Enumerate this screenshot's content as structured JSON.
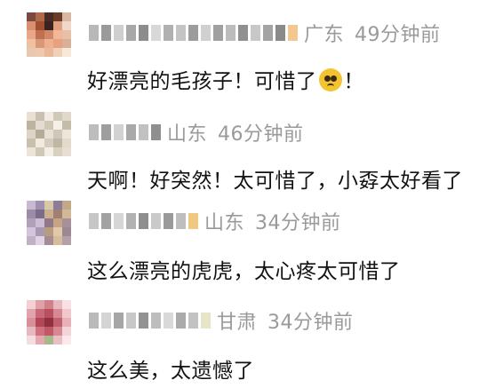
{
  "comments": [
    {
      "location": "广东",
      "time": "49分钟前",
      "text_before_emoji": "好漂亮的毛孩子！可惜了",
      "emoji": "pleading-face-icon",
      "text_after_emoji": "！"
    },
    {
      "location": "山东",
      "time": "46分钟前",
      "text": "天啊！好突然！太可惜了，小孬太好看了"
    },
    {
      "location": "山东",
      "time": "34分钟前",
      "text": "这么漂亮的虎虎，太心疼太可惜了"
    },
    {
      "location": "甘肃",
      "time": "34分钟前",
      "text": "这么美，太遗憾了"
    }
  ],
  "colors": {
    "meta_gray": "#9a9a9a",
    "text": "#121212",
    "background": "#ffffff"
  }
}
